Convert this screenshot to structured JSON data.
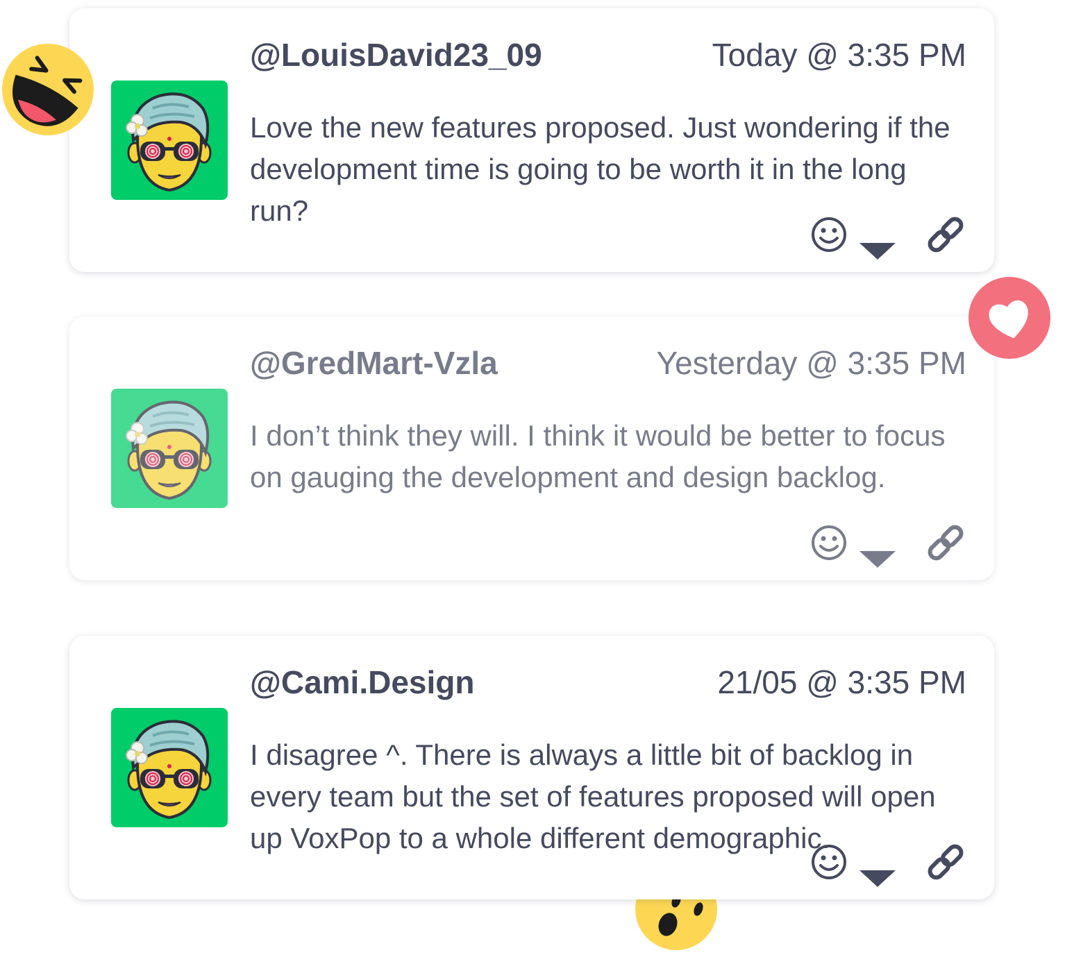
{
  "comments": [
    {
      "username": "@LouisDavid23_09",
      "timestamp": "Today @ 3:35 PM",
      "message": "Love the new features proposed. Just wondering if the development time is going to be worth it in the long run?"
    },
    {
      "username": "@GredMart-Vzla",
      "timestamp": "Yesterday @ 3:35 PM",
      "message": "I don’t think they will. I think it would be better to focus on gauging the development and design backlog."
    },
    {
      "username": "@Cami.Design",
      "timestamp": "21/05 @ 3:35 PM",
      "message": "I disagree ^. There is always a little bit of backlog in every team but the set of features proposed will open up VoxPop to a whole different demographic."
    }
  ],
  "icons": {
    "reaction": "smiley-icon",
    "dropdown": "caret-down-icon",
    "link": "link-icon",
    "floating": [
      "laughing-emoji-icon",
      "heart-reaction-icon",
      "wow-emoji-icon"
    ]
  },
  "colors": {
    "text": "#454a5e",
    "avatar_bg": "#00cc6a",
    "heart": "#f3707e",
    "emoji_yellow": "#fdd753"
  }
}
